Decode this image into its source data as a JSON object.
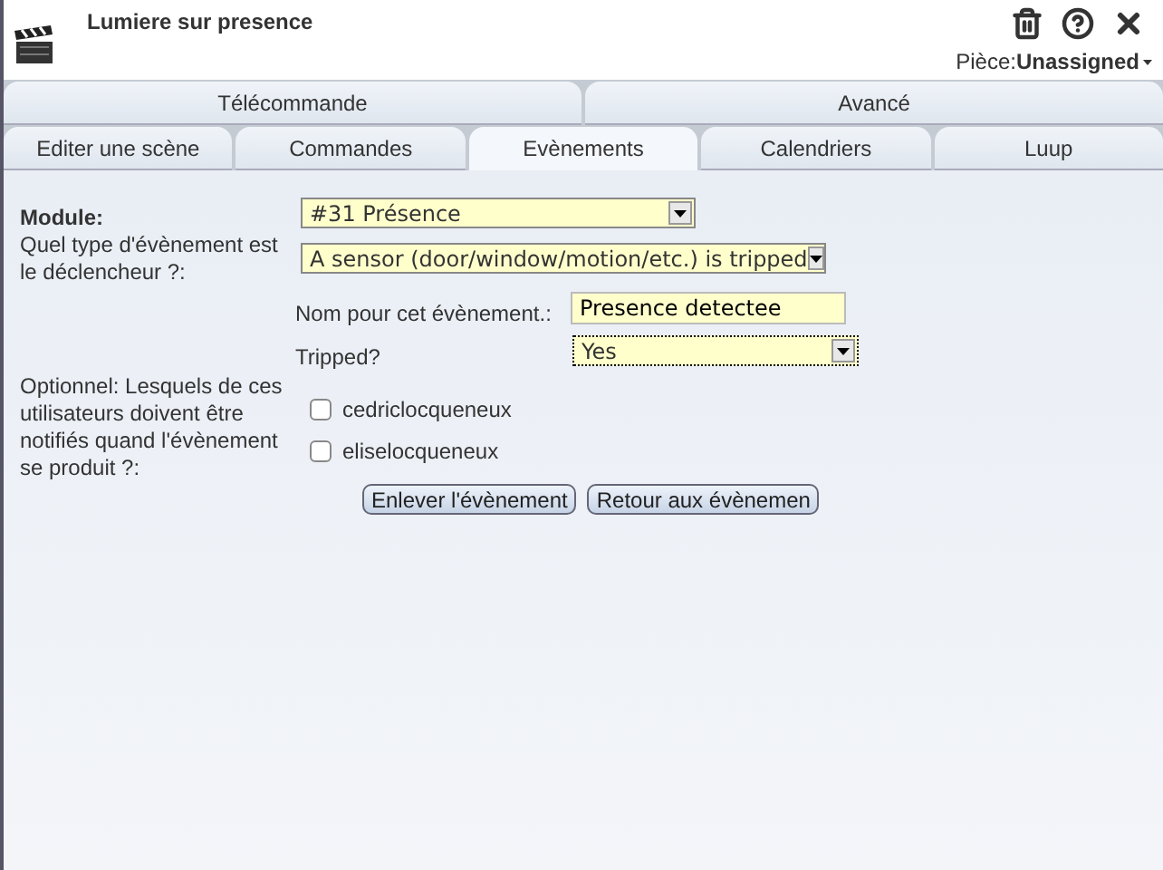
{
  "header": {
    "title": "Lumiere sur presence",
    "room_label": "Pièce:",
    "room_value": "Unassigned"
  },
  "tab_rows": [
    [
      {
        "label": "Télécommande",
        "selected": false
      },
      {
        "label": "Avancé",
        "selected": false
      }
    ],
    [
      {
        "label": "Editer une scène",
        "selected": false
      },
      {
        "label": "Commandes",
        "selected": false
      },
      {
        "label": "Evènements",
        "selected": true
      },
      {
        "label": "Calendriers",
        "selected": false
      },
      {
        "label": "Luup",
        "selected": false
      }
    ]
  ],
  "form": {
    "module_label": "Module:",
    "module_value": "#31 Présence",
    "trigger_label": "Quel type d'évènement est le déclencheur ?:",
    "trigger_value": "A sensor (door/window/motion/etc.) is tripped",
    "name_label": "Nom pour cet évènement.:",
    "name_value": "Presence detectee",
    "tripped_label": "Tripped?",
    "tripped_value": "Yes",
    "notify_label": "Optionnel: Lesquels de ces utilisateurs doivent être notifiés quand l'évènement se produit ?:",
    "users": [
      {
        "name": "cedriclocqueneux",
        "checked": false
      },
      {
        "name": "eliselocqueneux",
        "checked": false
      }
    ],
    "buttons": [
      "Enlever l'évènement",
      "Retour aux évènemen"
    ]
  }
}
